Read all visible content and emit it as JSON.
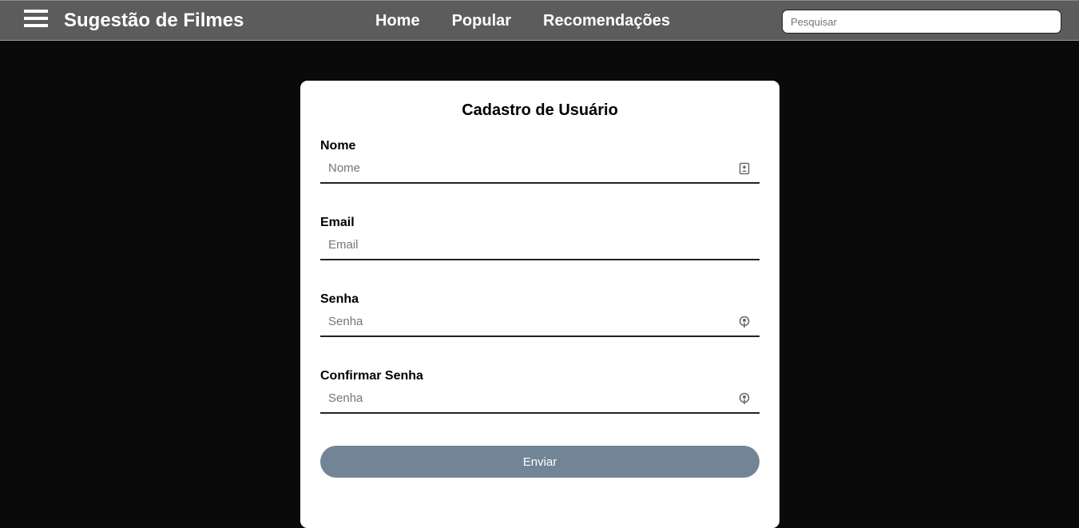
{
  "navbar": {
    "menu_icon": "hamburger-menu-icon",
    "brand": "Sugestão de Filmes",
    "links": [
      {
        "label": "Home"
      },
      {
        "label": "Popular"
      },
      {
        "label": "Recomendações"
      }
    ],
    "search": {
      "placeholder": "Pesquisar",
      "value": ""
    }
  },
  "form": {
    "title": "Cadastro de Usuário",
    "fields": [
      {
        "label": "Nome",
        "placeholder": "Nome",
        "value": "",
        "icon": "contact-card-icon"
      },
      {
        "label": "Email",
        "placeholder": "Email",
        "value": ""
      },
      {
        "label": "Senha",
        "placeholder": "Senha",
        "value": "",
        "icon": "password-key-icon"
      },
      {
        "label": "Confirmar Senha",
        "placeholder": "Senha",
        "value": "",
        "icon": "password-key-icon"
      }
    ],
    "submit_label": "Enviar"
  },
  "colors": {
    "navbar_bg": "#5c5c5c",
    "page_bg": "#0a0a0a",
    "card_bg": "#ffffff",
    "button_bg": "#718597"
  }
}
